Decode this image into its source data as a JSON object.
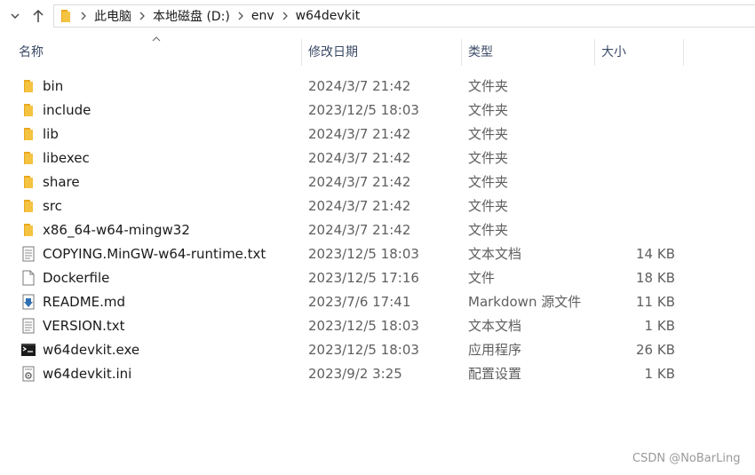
{
  "breadcrumb": [
    "此电脑",
    "本地磁盘 (D:)",
    "env",
    "w64devkit"
  ],
  "columns": {
    "name": "名称",
    "date": "修改日期",
    "type": "类型",
    "size": "大小"
  },
  "files": [
    {
      "icon": "folder-icon",
      "name": "bin",
      "date": "2024/3/7 21:42",
      "type": "文件夹",
      "size": ""
    },
    {
      "icon": "folder-icon",
      "name": "include",
      "date": "2023/12/5 18:03",
      "type": "文件夹",
      "size": ""
    },
    {
      "icon": "folder-icon",
      "name": "lib",
      "date": "2024/3/7 21:42",
      "type": "文件夹",
      "size": ""
    },
    {
      "icon": "folder-icon",
      "name": "libexec",
      "date": "2024/3/7 21:42",
      "type": "文件夹",
      "size": ""
    },
    {
      "icon": "folder-icon",
      "name": "share",
      "date": "2024/3/7 21:42",
      "type": "文件夹",
      "size": ""
    },
    {
      "icon": "folder-icon",
      "name": "src",
      "date": "2024/3/7 21:42",
      "type": "文件夹",
      "size": ""
    },
    {
      "icon": "folder-icon",
      "name": "x86_64-w64-mingw32",
      "date": "2024/3/7 21:42",
      "type": "文件夹",
      "size": ""
    },
    {
      "icon": "text-file-icon",
      "name": "COPYING.MinGW-w64-runtime.txt",
      "date": "2023/12/5 18:03",
      "type": "文本文档",
      "size": "14 KB"
    },
    {
      "icon": "blank-file-icon",
      "name": "Dockerfile",
      "date": "2023/12/5 17:16",
      "type": "文件",
      "size": "18 KB"
    },
    {
      "icon": "markdown-file-icon",
      "name": "README.md",
      "date": "2023/7/6 17:41",
      "type": "Markdown 源文件",
      "size": "11 KB"
    },
    {
      "icon": "text-file-icon",
      "name": "VERSION.txt",
      "date": "2023/12/5 18:03",
      "type": "文本文档",
      "size": "1 KB"
    },
    {
      "icon": "exe-file-icon",
      "name": "w64devkit.exe",
      "date": "2023/12/5 18:03",
      "type": "应用程序",
      "size": "26 KB"
    },
    {
      "icon": "ini-file-icon",
      "name": "w64devkit.ini",
      "date": "2023/9/2 3:25",
      "type": "配置设置",
      "size": "1 KB"
    }
  ],
  "watermark": "CSDN @NoBarLing",
  "colors": {
    "folder": "#f5c342",
    "header_text": "#3b4a66",
    "muted_text": "#5f5f5f"
  }
}
